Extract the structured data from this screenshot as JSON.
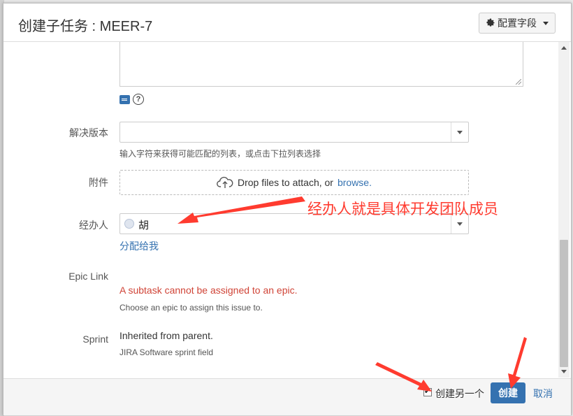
{
  "dialog": {
    "title": "创建子任务 : MEER-7",
    "config_button": "配置字段"
  },
  "fields": {
    "fix_version": {
      "label": "解决版本",
      "value": "",
      "hint": "输入字符来获得可能匹配的列表，或点击下拉列表选择"
    },
    "attachment": {
      "label": "附件",
      "drop_text": "Drop files to attach, or",
      "browse_link": "browse."
    },
    "assignee": {
      "label": "经办人",
      "value": "胡",
      "assign_to_me": "分配给我"
    },
    "epic_link": {
      "label": "Epic Link",
      "error": "A subtask cannot be assigned to an epic.",
      "hint": "Choose an epic to assign this issue to."
    },
    "sprint": {
      "label": "Sprint",
      "value": "Inherited from parent.",
      "hint": "JIRA Software sprint field"
    }
  },
  "footer": {
    "create_another_label": "创建另一个",
    "create_another_checked": true,
    "create_button": "创建",
    "cancel_link": "取消"
  },
  "annotation": {
    "text": "经办人就是具体开发团队成员",
    "color": "#ff3b2f"
  },
  "colors": {
    "primary": "#3572b0",
    "error": "#d04437"
  },
  "icons": [
    "gear-icon",
    "caret-down-icon",
    "document-icon",
    "help-icon",
    "upload-cloud-icon",
    "avatar-icon"
  ]
}
